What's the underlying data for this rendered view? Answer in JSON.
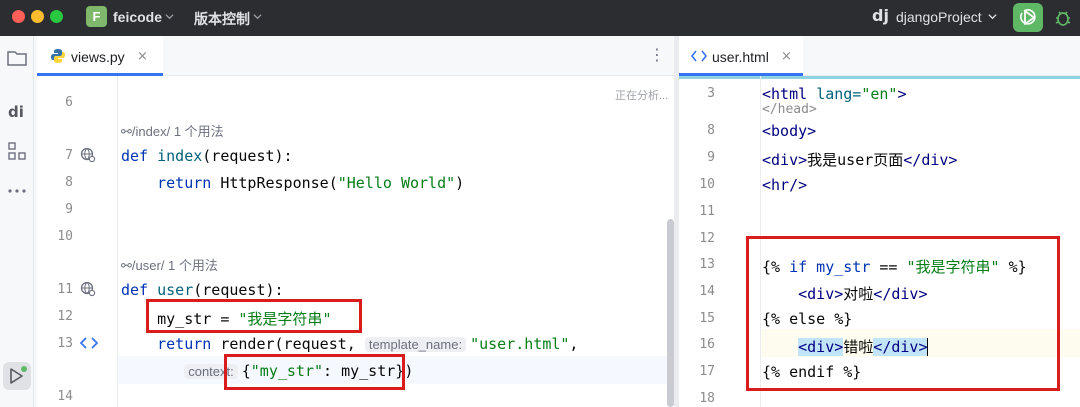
{
  "titlebar": {
    "project_badge": "F",
    "project_name": "feicode",
    "vcs_label": "版本控制",
    "django_icon": "dj",
    "run_config": "djangoProject"
  },
  "colors": {
    "accent": "#3574f0",
    "run_green": "#5fb865",
    "annotation_red": "#d91c1c"
  },
  "left_editor": {
    "tab_label": "views.py",
    "tab_close": "×",
    "analyzing": "正在分析...",
    "lines": {
      "l6": "6",
      "l7": "7",
      "l8": "8",
      "l9": "9",
      "l10": "10",
      "l11": "11",
      "l12": "12",
      "l13": "13",
      "l14": "14"
    },
    "usage_index": "/index/   1 个用法",
    "usage_user": "/user/   1 个用法",
    "code": {
      "def": "def",
      "index_fn": "index",
      "index_args": "(request):",
      "return": "return",
      "http_response": "HttpResponse(",
      "hello_str": "\"Hello World\"",
      "close_paren": ")",
      "user_fn": "user",
      "user_args": "(request):",
      "my_str_assign": "my_str = ",
      "my_str_value": "\"我是字符串\"",
      "render_call": "render(request, ",
      "template_hint": "template_name:",
      "template_value": "\"user.html\"",
      "comma": ",",
      "context_hint": "context:",
      "dict_open": "{",
      "dict_key": "\"my_str\"",
      "dict_rest": ": my_str",
      "dict_close": "}",
      "call_close": ")"
    }
  },
  "right_editor": {
    "tab_label": "user.html",
    "tab_close": "×",
    "lines": {
      "l3": "3",
      "l8": "8",
      "l9": "9",
      "l10": "10",
      "l11": "11",
      "l12": "12",
      "l13": "13",
      "l14": "14",
      "l15": "15",
      "l16": "16",
      "l17": "17",
      "l18": "18"
    },
    "code": {
      "html_open": "<html ",
      "lang_attr": "lang=",
      "lang_val": "\"en\"",
      "html_close": ">",
      "head_partial": "</head>",
      "body": "<body>",
      "div_open": "<div>",
      "div_text": "我是user页面",
      "div_close": "</div>",
      "hr": "<hr/>",
      "if_open": "{% ",
      "if_kw": "if",
      "if_var": " my_str ",
      "if_eq": "== ",
      "if_str": "\"我是字符串\"",
      "if_close": " %}",
      "div_a": "对啦",
      "else_line": "{% else %}",
      "div_b": "错啦",
      "endif_line": "{% endif %}"
    }
  }
}
